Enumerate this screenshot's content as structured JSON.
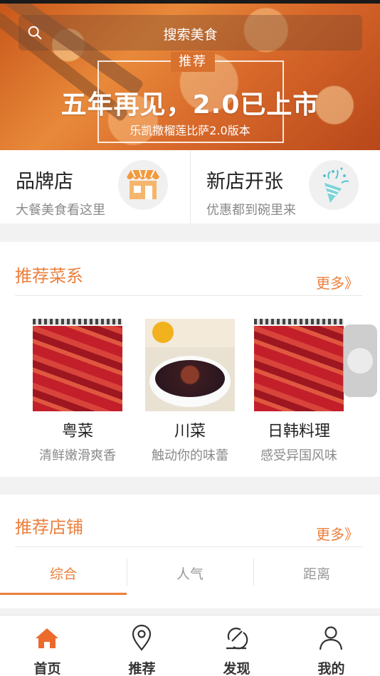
{
  "banner": {
    "search_placeholder": "搜索美食",
    "tag": "推荐",
    "title": "五年再见，2.0已上市",
    "subtitle": "乐凯撒榴莲比萨2.0版本"
  },
  "store_types": [
    {
      "title": "品牌店",
      "subtitle": "大餐美食看这里",
      "icon": "storefront-icon"
    },
    {
      "title": "新店开张",
      "subtitle": "优惠都到碗里来",
      "icon": "party-popper-icon"
    }
  ],
  "cuisines": {
    "title": "推荐菜系",
    "more": "更多》",
    "items": [
      {
        "name": "粤菜",
        "desc": "清鲜嫩滑爽香"
      },
      {
        "name": "川菜",
        "desc": "触动你的味蕾"
      },
      {
        "name": "日韩料理",
        "desc": "感受异国风味"
      }
    ]
  },
  "shops": {
    "title": "推荐店铺",
    "more": "更多》",
    "tabs": [
      "综合",
      "人气",
      "距离"
    ],
    "active_tab": 0
  },
  "bottom_nav": {
    "items": [
      {
        "label": "首页",
        "icon": "home-icon"
      },
      {
        "label": "推荐",
        "icon": "location-pin-icon"
      },
      {
        "label": "发现",
        "icon": "discover-icon"
      },
      {
        "label": "我的",
        "icon": "user-icon"
      }
    ],
    "active": 0
  },
  "colors": {
    "accent": "#ec7f3c",
    "text_primary": "#222222",
    "text_secondary": "#8a8a8a",
    "home_active": "#ec6a2c"
  }
}
